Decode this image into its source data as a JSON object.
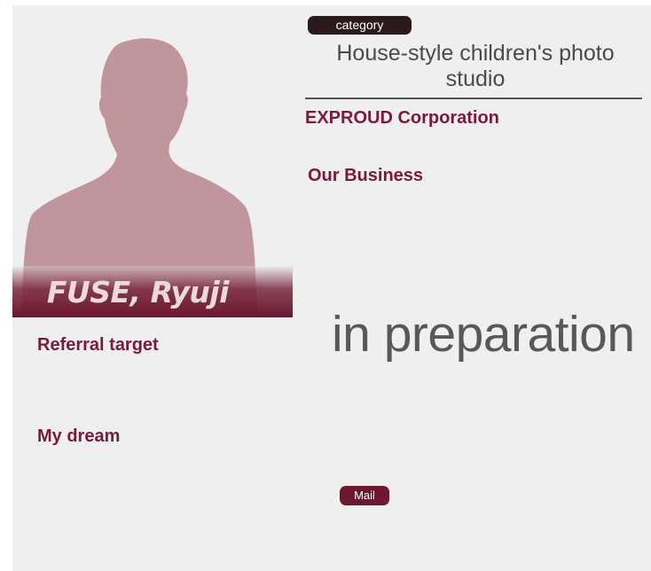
{
  "profile": {
    "name": "FUSE, Ryuji",
    "photo": "person-silhouette-icon"
  },
  "header": {
    "category_label": "category",
    "title": "House-style children's photo studio",
    "company": "EXPROUD Corporation"
  },
  "sections": {
    "business_label": "Our Business",
    "referral_label": "Referral target",
    "dream_label": "My dream"
  },
  "status": {
    "placeholder_text": "in preparation"
  },
  "actions": {
    "mail_label": "Mail"
  },
  "colors": {
    "accent": "#7a1a36",
    "silhouette": "#c0959c",
    "background": "#efefef"
  }
}
